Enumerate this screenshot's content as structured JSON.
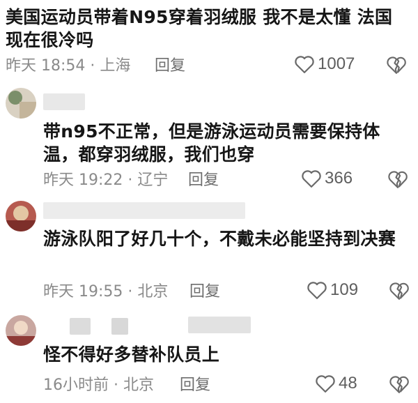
{
  "comments": [
    {
      "text": "美国运动员带着N95穿着羽绒服 我不是太懂 法国现在很冷吗",
      "meta": "昨天 18:54 · 上海",
      "reply": "回复",
      "likes": "1007"
    },
    {
      "text": "带n95不正常，但是游泳运动员需要保持体温，都穿羽绒服，我们也穿",
      "meta": "昨天 19:22 · 辽宁",
      "reply": "回复",
      "likes": "366"
    },
    {
      "text": "游泳队阳了好几十个，不戴未必能坚持到决赛",
      "meta": "昨天 19:55 · 北京",
      "reply": "回复",
      "likes": "109"
    },
    {
      "text": "怪不得好多替补队员上",
      "meta": "16小时前 · 北京",
      "reply": "回复",
      "likes": "48"
    }
  ],
  "icons": {
    "like": "heart-outline-icon",
    "dislike": "broken-heart-icon"
  },
  "colors": {
    "text": "#161616",
    "meta": "#8a8a8a",
    "icon": "#6a6a6a"
  }
}
